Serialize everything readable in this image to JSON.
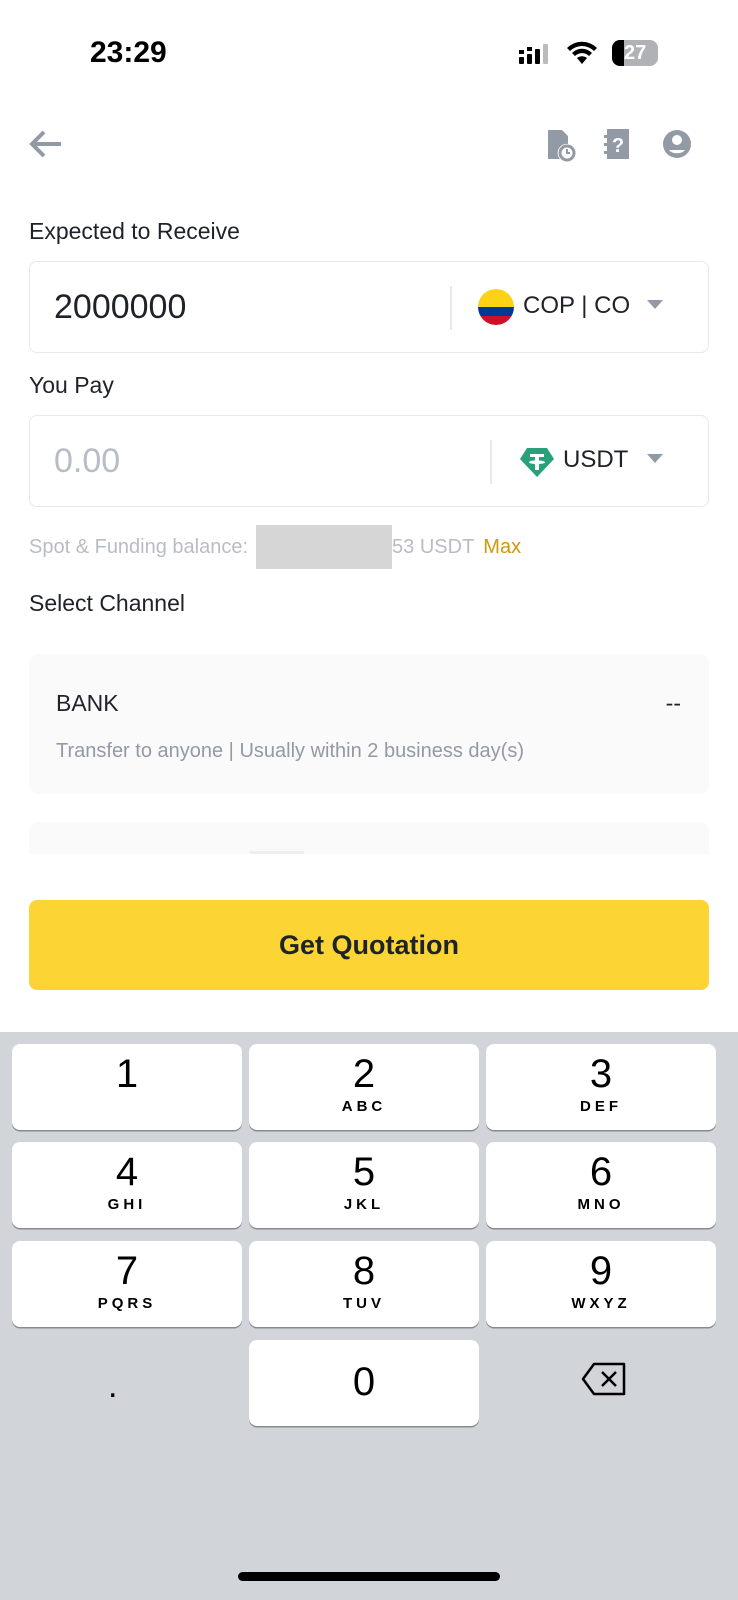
{
  "status": {
    "time": "23:29",
    "battery": "27"
  },
  "header": {
    "icons": [
      "back-arrow-icon",
      "order-history-icon",
      "help-icon",
      "account-icon"
    ]
  },
  "receive": {
    "label": "Expected to Receive",
    "value": "2000000",
    "currency": "COP | CO"
  },
  "pay": {
    "label": "You Pay",
    "placeholder": "0.00",
    "currency": "USDT"
  },
  "balance": {
    "prefix": "Spot & Funding balance:",
    "suffix": "53 USDT",
    "max": "Max"
  },
  "channel": {
    "title": "Select Channel",
    "items": [
      {
        "name": "BANK",
        "value": "--",
        "desc": "Transfer to anyone | Usually within 2 business day(s)"
      }
    ]
  },
  "button": {
    "label": "Get Quotation"
  },
  "colors": {
    "accent": "#fcd535",
    "max": "#d0980b",
    "tether": "#26a17b"
  },
  "keyboard": {
    "keys": [
      {
        "d": "1",
        "l": ""
      },
      {
        "d": "2",
        "l": "ABC"
      },
      {
        "d": "3",
        "l": "DEF"
      },
      {
        "d": "4",
        "l": "GHI"
      },
      {
        "d": "5",
        "l": "JKL"
      },
      {
        "d": "6",
        "l": "MNO"
      },
      {
        "d": "7",
        "l": "PQRS"
      },
      {
        "d": "8",
        "l": "TUV"
      },
      {
        "d": "9",
        "l": "WXYZ"
      },
      {
        "d": ".",
        "l": ""
      },
      {
        "d": "0",
        "l": ""
      }
    ]
  }
}
